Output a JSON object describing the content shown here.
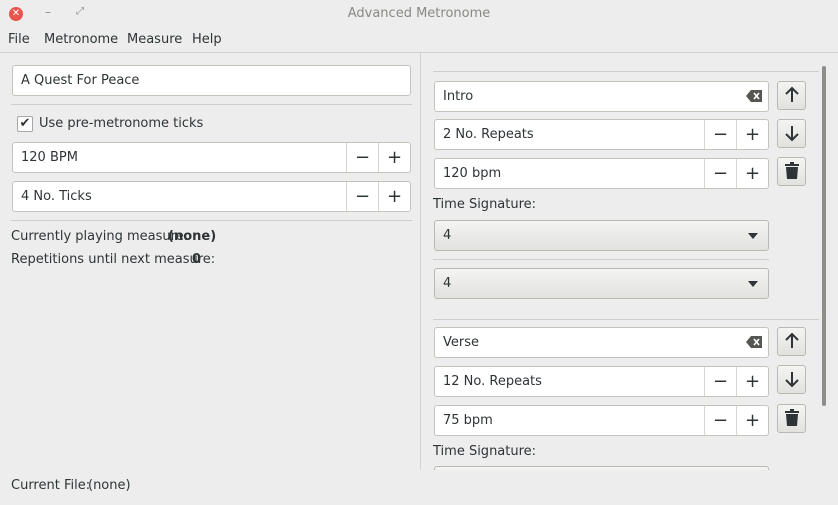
{
  "window": {
    "title": "Advanced Metronome"
  },
  "menu": {
    "file": "File",
    "metronome": "Metronome",
    "measure": "Measure",
    "help": "Help"
  },
  "song": {
    "name": "A Quest For Peace"
  },
  "pre_ticks": {
    "label": "Use pre-metronome ticks",
    "checked": true,
    "bpm": "120 BPM",
    "ticks": "4 No. Ticks"
  },
  "status": {
    "playing_label": "Currently playing measure:",
    "playing_value": "(none)",
    "reps_label": "Repetitions until next measure:",
    "reps_value": "0",
    "file_label": "Current File:",
    "file_value": "(none)"
  },
  "measures": [
    {
      "name": "Intro",
      "repeats": "2 No. Repeats",
      "bpm": "120 bpm",
      "ts_label": "Time Signature:",
      "ts_top": "4",
      "ts_bottom": "4"
    },
    {
      "name": "Verse",
      "repeats": "12 No. Repeats",
      "bpm": "75 bpm",
      "ts_label": "Time Signature:"
    }
  ],
  "glyphs": {
    "minus": "−",
    "plus": "+",
    "up": "🡑",
    "down": "🡓",
    "check": "✔",
    "close": "✕",
    "minimize": "–",
    "maximize": "⤢"
  },
  "icons": {
    "close": "close-icon",
    "minimize": "minimize-icon",
    "maximize": "maximize-icon",
    "clear": "clear-text-icon",
    "up": "arrow-up-icon",
    "down": "arrow-down-icon",
    "delete": "trash-icon",
    "dropdown": "chevron-down-icon"
  },
  "colors": {
    "close_button": "#e9554c",
    "background": "#ededed"
  }
}
